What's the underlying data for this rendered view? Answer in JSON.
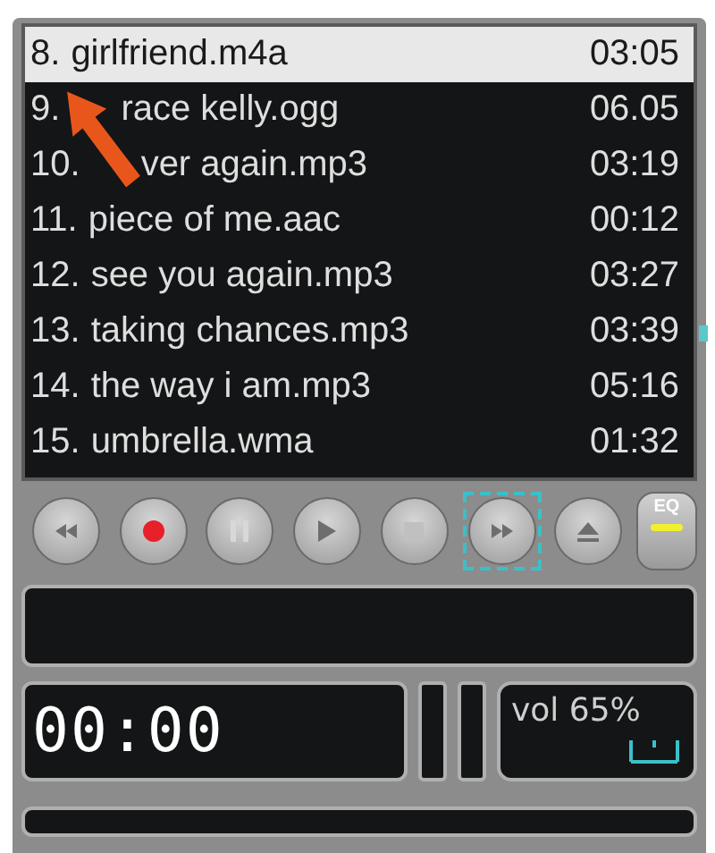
{
  "playlist": {
    "tracks": [
      {
        "number": "8.",
        "title": "girlfriend.m4a",
        "time": "03:05",
        "selected": true,
        "covered": false
      },
      {
        "number": "9.",
        "title": "race kelly.ogg",
        "time": "06.05",
        "selected": false,
        "covered": true
      },
      {
        "number": "10.",
        "title": "ver again.mp3",
        "time": "03:19",
        "selected": false,
        "covered": true
      },
      {
        "number": "11.",
        "title": "piece of me.aac",
        "time": "00:12",
        "selected": false,
        "covered": false
      },
      {
        "number": "12.",
        "title": "see you again.mp3",
        "time": "03:27",
        "selected": false,
        "covered": false
      },
      {
        "number": "13.",
        "title": "taking chances.mp3",
        "time": "03:39",
        "selected": false,
        "covered": false
      },
      {
        "number": "14.",
        "title": "the way i am.mp3",
        "time": "05:16",
        "selected": false,
        "covered": false
      },
      {
        "number": "15.",
        "title": "umbrella.wma",
        "time": "01:32",
        "selected": false,
        "covered": false
      }
    ]
  },
  "controls": [
    {
      "kind": "rewind",
      "focused": false
    },
    {
      "kind": "record",
      "focused": false
    },
    {
      "kind": "pause",
      "focused": false
    },
    {
      "kind": "play",
      "focused": false
    },
    {
      "kind": "stop",
      "focused": false
    },
    {
      "kind": "forward",
      "focused": true
    },
    {
      "kind": "eject",
      "focused": false
    },
    {
      "kind": "eq",
      "label": "EQ",
      "focused": false
    }
  ],
  "clock": "00:00",
  "volume": {
    "label": "vol 65%"
  }
}
